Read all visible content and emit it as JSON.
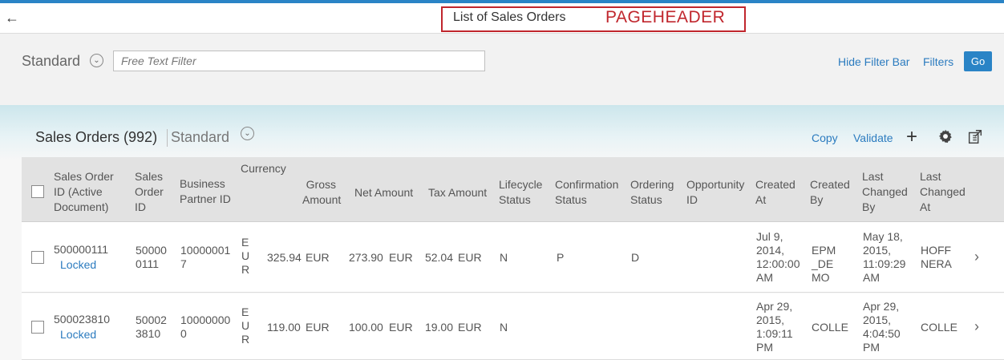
{
  "shell": {
    "title": "List of Sales Orders",
    "pageheader_tag": "PAGEHEADER"
  },
  "filterbar": {
    "variant": "Standard",
    "search_placeholder": "Free Text Filter",
    "hide_filter_bar": "Hide Filter Bar",
    "filters": "Filters",
    "go": "Go"
  },
  "table": {
    "title": "Sales Orders (992)",
    "variant": "Standard",
    "copy": "Copy",
    "validate": "Validate",
    "columns": [
      "Sales Order ID (Active Document)",
      "Sales Order ID",
      "Business Partner ID",
      "Currency",
      "Gross Amount",
      "Net Amount",
      "Tax Amount",
      "Lifecycle Status",
      "Confirmation Status",
      "Ordering Status",
      "Opportunity ID",
      "Created At",
      "Created By",
      "Last Changed By",
      "Last Changed At"
    ],
    "rows": [
      {
        "sales_order_id_active": "500000111",
        "lock_status": "Locked",
        "sales_order_id": "500000111",
        "business_partner_id": "100000017",
        "currency": "EUR",
        "gross_amount": "325.94",
        "gross_currency": "EUR",
        "net_amount": "273.90",
        "net_currency": "EUR",
        "tax_amount": "52.04",
        "tax_currency": "EUR",
        "lifecycle_status": "N",
        "confirmation_status": "P",
        "ordering_status": "D",
        "opportunity_id": "",
        "created_at": "Jul 9, 2014, 12:00:00 AM",
        "created_by": "EPM_DEMO",
        "last_changed_by": "May 18, 2015, 11:09:29 AM",
        "last_changed_at": "HOFFNERA"
      },
      {
        "sales_order_id_active": "500023810",
        "lock_status": "Locked",
        "sales_order_id": "500023810",
        "business_partner_id": "100000000",
        "currency": "EUR",
        "gross_amount": "119.00",
        "gross_currency": "EUR",
        "net_amount": "100.00",
        "net_currency": "EUR",
        "tax_amount": "19.00",
        "tax_currency": "EUR",
        "lifecycle_status": "N",
        "confirmation_status": "",
        "ordering_status": "",
        "opportunity_id": "",
        "created_at": "Apr 29, 2015, 1:09:11 PM",
        "created_by": "COLLE",
        "last_changed_by": "Apr 29, 2015, 4:04:50 PM",
        "last_changed_at": "COLLE"
      }
    ]
  },
  "icons": {
    "back": "back-arrow-icon",
    "variant_toggle": "chevron-down-circle-icon",
    "add": "plus-icon",
    "settings": "gear-icon",
    "export": "export-icon",
    "navigate": "chevron-right-icon"
  },
  "colors": {
    "accent": "#2a84c6",
    "link": "#2b7bbf",
    "highlight_box": "#c0262d"
  }
}
